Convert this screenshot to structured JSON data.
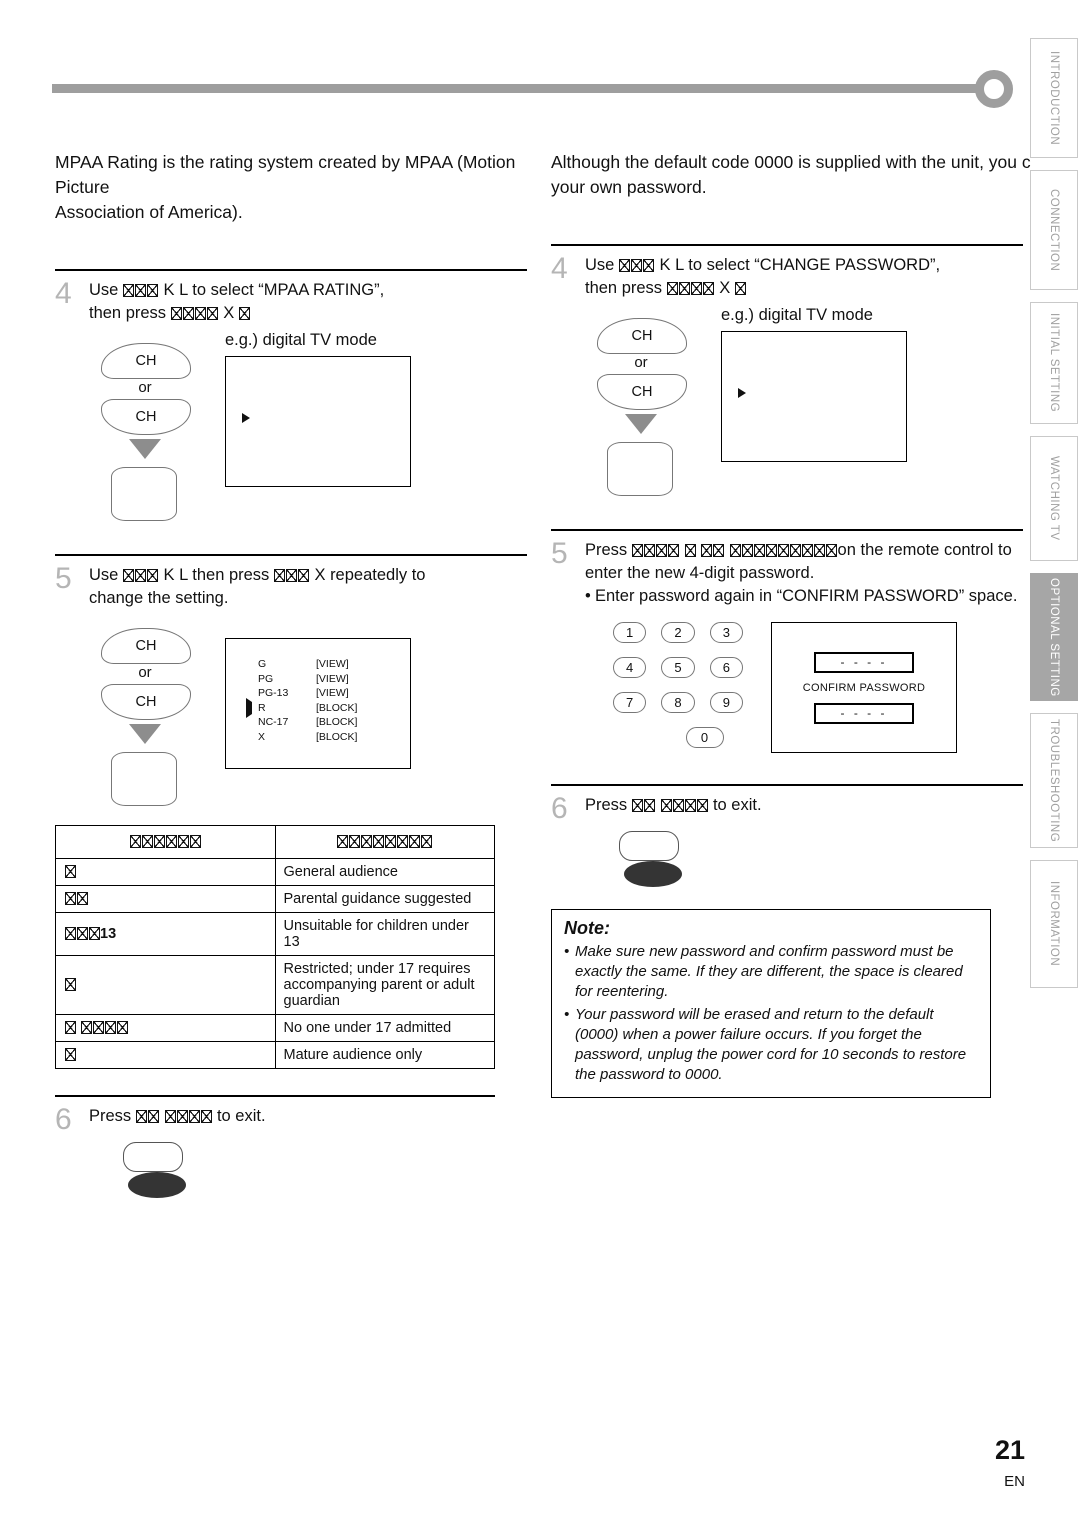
{
  "document": {
    "page_number": "21",
    "language_code": "EN"
  },
  "side_tabs": [
    {
      "label": "INTRODUCTION",
      "active": false
    },
    {
      "label": "CONNECTION",
      "active": false
    },
    {
      "label": "INITIAL  SETTING",
      "active": false
    },
    {
      "label": "WATCHING  TV",
      "active": false
    },
    {
      "label": "OPTIONAL  SETTING",
      "active": true
    },
    {
      "label": "TROUBLESHOOTING",
      "active": false
    },
    {
      "label": "INFORMATION",
      "active": false
    }
  ],
  "left_column": {
    "intro_line1": "MPAA Rating is the rating system created by MPAA (Motion Picture",
    "intro_line2": "Association of America).",
    "step4": {
      "number": "4",
      "text_prefix": "Use ",
      "text_mid": " K  L  to select “MPAA RATING”,",
      "text_line2_prefix": "then press ",
      "text_line2_suffix": " X ",
      "eg_label": "e.g.) digital TV mode",
      "ch_up_label": "CH",
      "ch_or_label": "or",
      "ch_down_label": "CH"
    },
    "step5": {
      "number": "5",
      "text_prefix": "Use ",
      "text_mid": " K  L  then press ",
      "text_suffix": " X  repeatedly to",
      "text_line2": "change the setting.",
      "ch_up_label": "CH",
      "ch_or_label": "or",
      "ch_down_label": "CH",
      "osd_rows": [
        {
          "mark": "",
          "name": "G",
          "value": "[VIEW]"
        },
        {
          "mark": "",
          "name": "PG",
          "value": "[VIEW]"
        },
        {
          "mark": "",
          "name": "PG-13",
          "value": "[VIEW]"
        },
        {
          "mark": "caret",
          "name": "R",
          "value": "[BLOCK]"
        },
        {
          "mark": "",
          "name": "NC-17",
          "value": "[BLOCK]"
        },
        {
          "mark": "",
          "name": "X",
          "value": "[BLOCK]"
        }
      ]
    },
    "rating_table": {
      "headers": [
        "☒☒☒☒☒☒",
        "☒☒☒☒☒☒☒☒"
      ],
      "rows": [
        {
          "rating_boxes": 1,
          "rating_suffix": "",
          "description": "General audience"
        },
        {
          "rating_boxes": 2,
          "rating_suffix": "",
          "description": "Parental guidance suggested"
        },
        {
          "rating_boxes": 3,
          "rating_suffix": "13",
          "description": "Unsuitable for children under 13"
        },
        {
          "rating_boxes": 1,
          "rating_suffix": "",
          "description": "Restricted; under 17 requires accompanying parent or adult guardian"
        },
        {
          "rating_boxes": 5,
          "rating_suffix": "",
          "description": "No one under 17 admitted"
        },
        {
          "rating_boxes": 1,
          "rating_suffix": "",
          "description": "Mature audience only"
        }
      ]
    },
    "step6": {
      "number": "6",
      "text_prefix": "Press ",
      "text_suffix": " to exit."
    }
  },
  "right_column": {
    "intro_line1": "Although the default code  0000  is supplied with the unit, you c",
    "intro_line2": "your own password.",
    "step4": {
      "number": "4",
      "text_prefix": "Use ",
      "text_mid": " K  L  to select “CHANGE PASSWORD”,",
      "text_line2_prefix": "then press ",
      "text_line2_suffix": " X ",
      "eg_label": "e.g.) digital TV mode",
      "ch_up_label": "CH",
      "ch_or_label": "or",
      "ch_down_label": "CH"
    },
    "step5": {
      "number": "5",
      "text_prefix": "Press ",
      "text_suffix": "on the remote control to",
      "text_line2": "enter the new 4-digit password.",
      "bullet": "Enter password again in “CONFIRM PASSWORD” space.",
      "keypad": [
        [
          "1",
          "2",
          "3"
        ],
        [
          "4",
          "5",
          "6"
        ],
        [
          "7",
          "8",
          "9"
        ],
        [
          "0"
        ]
      ],
      "confirm_panel": {
        "field_top": "- - - -",
        "label": "CONFIRM PASSWORD",
        "field_bottom": "- - - -"
      }
    },
    "step6": {
      "number": "6",
      "text_prefix": "Press ",
      "text_suffix": " to exit."
    },
    "note": {
      "title": "Note:",
      "items": [
        "Make sure new password and confirm password must be exactly the same. If they are different, the space is cleared for reentering.",
        "Your password will be erased and return to the default (0000) when a power failure occurs. If you forget the password, unplug the power cord for 10 seconds to restore the password to 0000."
      ]
    }
  },
  "colors": {
    "rule": "#9e9e9e",
    "step_number": "#b5b5b5",
    "tab_inactive_text": "#a0a0a0",
    "tab_active_bg": "#a6a6a6",
    "arrow": "#8d8d8d"
  }
}
